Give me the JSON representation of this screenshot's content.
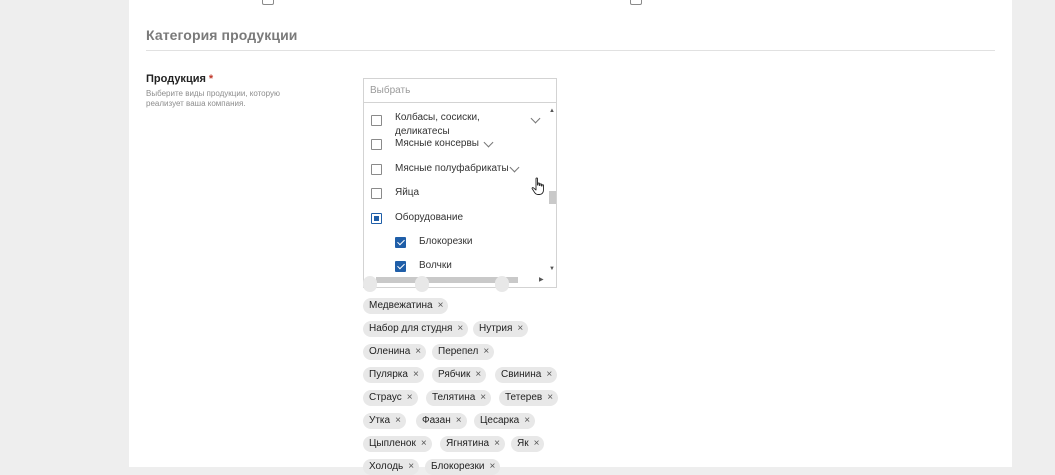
{
  "section": {
    "title": "Категория продукции"
  },
  "field": {
    "label": "Продукция",
    "required_mark": "*",
    "help_line_1": "Выберите виды продукции, которую",
    "help_line_2": "реализует ваша компания."
  },
  "select": {
    "placeholder": "Выбрать",
    "options": [
      {
        "label_line_1": "Колбасы, сосиски,",
        "label_line_2": "деликатесы",
        "state": "unchecked",
        "expandable": true
      },
      {
        "label": "Мясные консервы",
        "state": "unchecked",
        "expandable": true
      },
      {
        "label": "Мясные полуфабрикаты",
        "state": "unchecked",
        "expandable": true
      },
      {
        "label": "Яйца",
        "state": "unchecked",
        "expandable": false
      },
      {
        "label": "Оборудование",
        "state": "partial",
        "expandable": false
      },
      {
        "label": "Блокорезки",
        "state": "checked",
        "child": true
      },
      {
        "label": "Волчки",
        "state": "checked",
        "child": true
      }
    ]
  },
  "chips": [
    "Медвежатина",
    "Набор для студня",
    "Нутрия",
    "Оленина",
    "Перепел",
    "Пулярка",
    "Рябчик",
    "Свинина",
    "Страус",
    "Телятина",
    "Тетерев",
    "Утка",
    "Фазан",
    "Цесарка",
    "Цыпленок",
    "Ягнятина",
    "Як",
    "Холодь",
    "Блокорезки"
  ],
  "chip_remove_glyph": "×",
  "colors": {
    "accent": "#1f5ea8",
    "required": "#c0392b",
    "chip_bg": "#e8e8e8"
  }
}
